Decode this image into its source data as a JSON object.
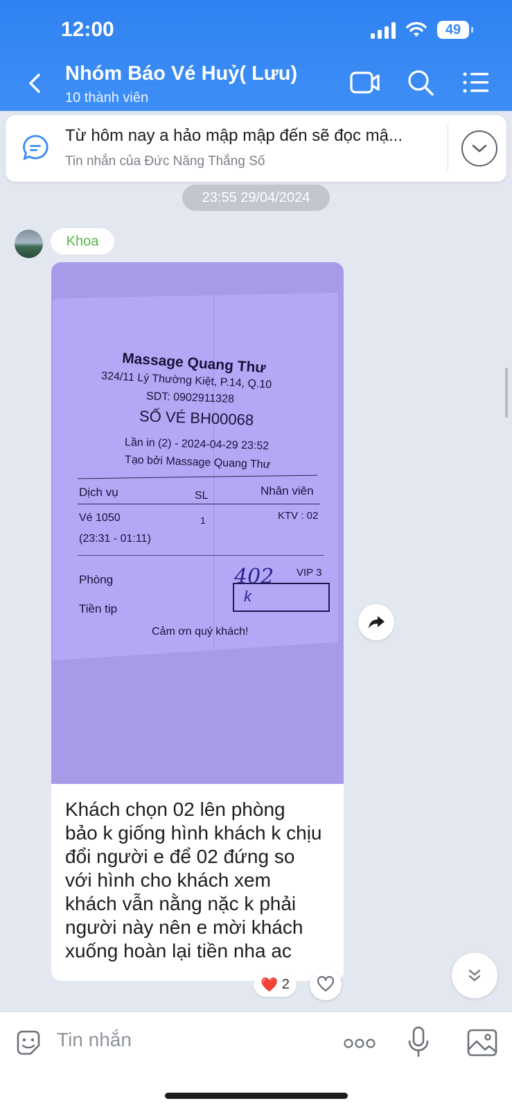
{
  "status_bar": {
    "time": "12:00",
    "battery": "49"
  },
  "header": {
    "title": "Nhóm Báo Vé Huỷ( Lưu)",
    "subtitle": "10 thành viên"
  },
  "pinned": {
    "text": "Từ hôm nay a hảo mập mập đến sẽ đọc mậ...",
    "sender": "Tin nhắn của Đức Năng Thắng Số"
  },
  "chat": {
    "timestamp": "23:55 29/04/2024",
    "sender": "Khoa",
    "receipt": {
      "shop": "Massage Quang Thư",
      "address": "324/11 Lý Thường Kiệt, P.14, Q.10",
      "phone": "SDT: 0902911328",
      "ticket": "SỐ VÉ BH00068",
      "print": "Lần in (2) - 2024-04-29 23:52",
      "created_by": "Tạo bởi Massage Quang Thư",
      "col_service": "Dịch vụ",
      "col_qty": "SL",
      "col_staff": "Nhân viên",
      "service": "Vé 1050",
      "qty": "1",
      "staff": "KTV : 02",
      "time_range": "(23:31 - 01:11)",
      "room_label": "Phòng",
      "room_value": "402",
      "room_type": "VIP 3",
      "tip_label": "Tiền tip",
      "tip_value": "k",
      "thanks": "Cảm ơn quý khách!"
    },
    "message_lines": [
      "Khách chọn 02 lên phòng",
      "bảo k giống hình khách k chịu",
      "đổi người e để 02 đứng so",
      "với hình cho khách xem",
      "khách vẫn nằng nặc k phải",
      "người này nên e mời khách",
      "xuống hoàn lại tiền nha ac"
    ],
    "reaction": {
      "emoji": "❤️",
      "count": "2"
    }
  },
  "input": {
    "placeholder": "Tin nhắn"
  }
}
